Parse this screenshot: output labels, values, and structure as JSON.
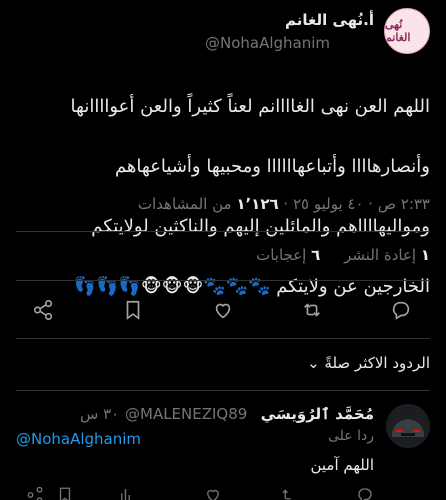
{
  "author": {
    "name": "أ.نُهى الغانم",
    "handle": "@NohaAlghanim",
    "avatar_text": "نُهى الغانم"
  },
  "tweet": {
    "lines": [
      "اللهم العن نهى الغاااانم لعناً كثيراً  والعن أعواااانها",
      "وأنصارهاااا وأتباعهاااااا ومحبيها وأشياعهاهم",
      "ومواليهااااهم والمائلين إليهم والناكثين لولايتكم",
      "الخارجين عن ولايتكم 🐾🐾🐾🐵🐵🐵👣👣👣"
    ],
    "emoji": "👣👣👣🐵🐵🐵🐾🐾🐾"
  },
  "meta": {
    "time": "٢:٣٣ ص",
    "date": "٤٠ يوليو ٢٥",
    "views_count": "١٬١٢٦",
    "views_label": "من المشاهدات"
  },
  "stats": {
    "reposts_count": "١",
    "reposts_label": "إعادة النشر",
    "likes_count": "٦",
    "likes_label": "إعجابات"
  },
  "actions": [
    "share-icon",
    "bookmark-icon",
    "like-icon",
    "repost-icon",
    "reply-icon"
  ],
  "replies_sort": {
    "label": "الردود الاكثر صلةً",
    "chevron": "⌄"
  },
  "reply": {
    "name": "مُحَمَّد ٱلرُوَيسَي",
    "handle": "@MALENEZIQ89",
    "time": "٣٠ س",
    "replying_to_label": "ردا على",
    "replying_to_handle": "@NohaAlghanim",
    "text": "اللهم آمين"
  },
  "colors": {
    "background": "#000000",
    "text": "#e7e9ea",
    "secondary": "#71767b",
    "link": "#1d9bf0",
    "divider": "#2f3336"
  }
}
